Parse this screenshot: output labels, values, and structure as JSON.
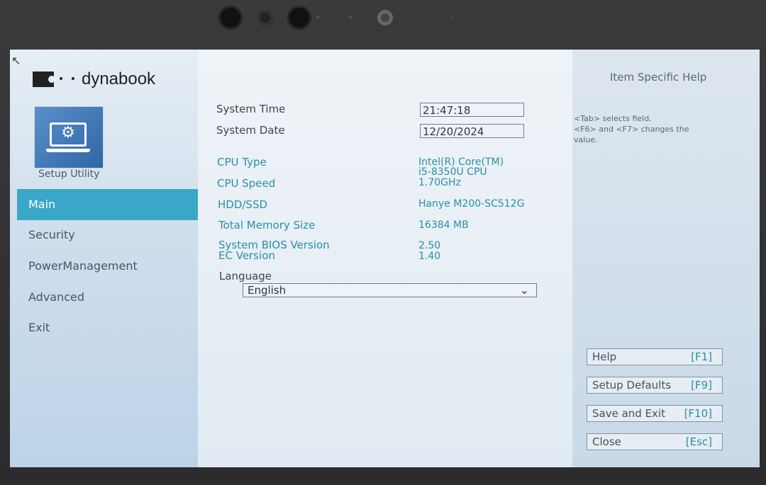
{
  "brand": {
    "name": "dynabook",
    "dots": "• •"
  },
  "sidebar": {
    "setup_label": "Setup Utility",
    "items": [
      {
        "label": "Main",
        "active": true
      },
      {
        "label": "Security"
      },
      {
        "label": "PowerManagement"
      },
      {
        "label": "Advanced"
      },
      {
        "label": "Exit"
      }
    ]
  },
  "main": {
    "system_time": {
      "label": "System Time",
      "value": "21:47:18"
    },
    "system_date": {
      "label": "System Date",
      "value": "12/20/2024"
    },
    "cpu_type": {
      "label": "CPU Type",
      "value_line1": "Intel(R) Core(TM)",
      "value_line2": "i5-8350U CPU"
    },
    "cpu_speed": {
      "label": "CPU Speed",
      "value": "1.70GHz"
    },
    "hdd": {
      "label": "HDD/SSD",
      "value": "Hanye M200-SC512G"
    },
    "memory": {
      "label": "Total Memory Size",
      "value": "16384 MB"
    },
    "bios": {
      "label": "System BIOS Version",
      "value": "2.50"
    },
    "ec": {
      "label": "EC Version",
      "value": "1.40"
    },
    "language": {
      "label": "Language",
      "value": "English"
    }
  },
  "help": {
    "title": "Item Specific Help",
    "line1": "<Tab> selects field.",
    "line2": "<F6> and <F7> changes the",
    "line3": "value."
  },
  "buttons": [
    {
      "label": "Help",
      "key": "[F1]"
    },
    {
      "label": "Setup Defaults",
      "key": "[F9]"
    },
    {
      "label": "Save and Exit",
      "key": "[F10]"
    },
    {
      "label": "Close",
      "key": "[Esc]"
    }
  ],
  "colors": {
    "accent": "#3aa7c9",
    "teal_text": "#2a8fa8"
  }
}
